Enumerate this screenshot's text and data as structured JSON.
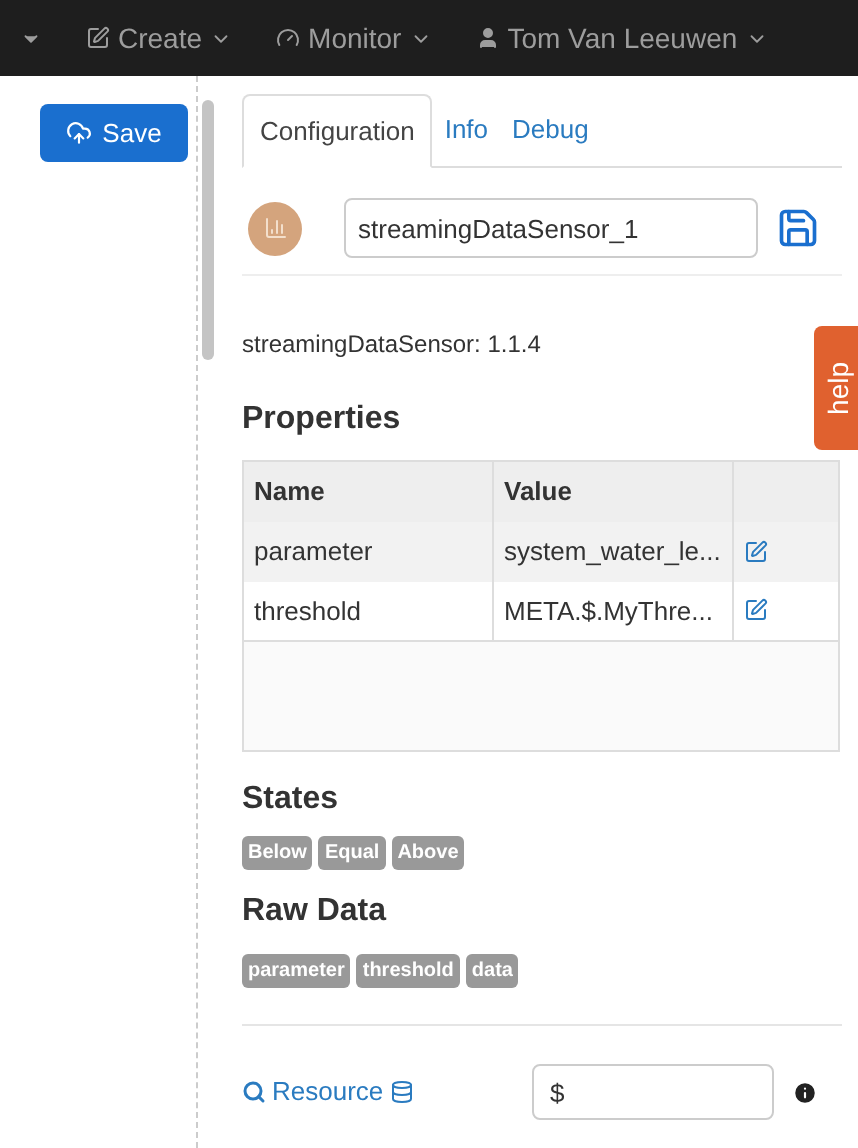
{
  "navbar": {
    "items": [
      {
        "label": "Create",
        "kind": "edit"
      },
      {
        "label": "Monitor",
        "kind": "dashboard"
      },
      {
        "label": "Tom Van Leeuwen",
        "kind": "user"
      }
    ]
  },
  "sidebar": {
    "save_button": "Save"
  },
  "tabs": [
    {
      "label": "Configuration",
      "selected": true
    },
    {
      "label": "Info",
      "selected": false
    },
    {
      "label": "Debug",
      "selected": false
    }
  ],
  "name_field": {
    "value": "streamingDataSensor_1"
  },
  "version": "streamingDataSensor: 1.1.4",
  "help_tab": "help",
  "properties": {
    "title": "Properties",
    "columns": [
      "Name",
      "Value"
    ],
    "rows": [
      {
        "name": "parameter",
        "value": "system_water_le..."
      },
      {
        "name": "threshold",
        "value": "META.$.MyThre..."
      }
    ]
  },
  "states": {
    "title": "States",
    "badges": [
      "Below",
      "Equal",
      "Above"
    ]
  },
  "raw_data": {
    "title": "Raw Data",
    "badges": [
      "parameter",
      "threshold",
      "data"
    ]
  },
  "resource": {
    "label": "Resource",
    "value": "$"
  }
}
